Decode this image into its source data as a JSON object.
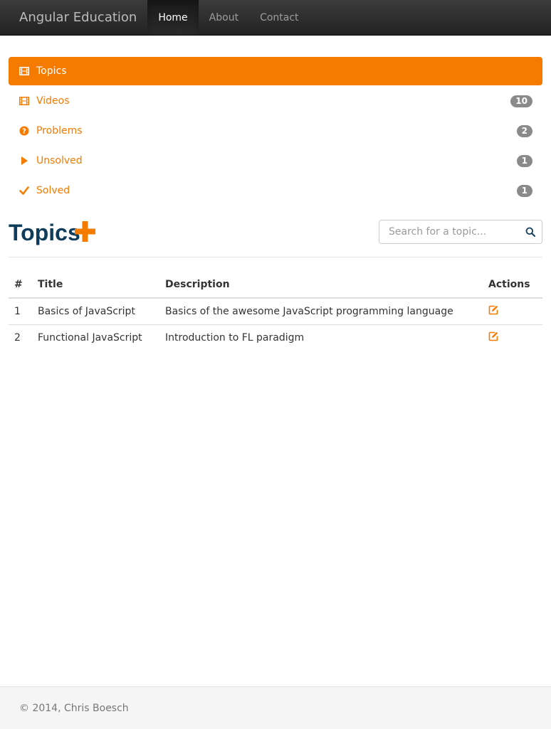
{
  "navbar": {
    "brand": "Angular Education",
    "links": [
      {
        "label": "Home",
        "active": true
      },
      {
        "label": "About",
        "active": false
      },
      {
        "label": "Contact",
        "active": false
      }
    ]
  },
  "menu": [
    {
      "label": "Topics",
      "icon": "film-icon",
      "badge": null,
      "active": true
    },
    {
      "label": "Videos",
      "icon": "film-icon",
      "badge": "10",
      "active": false
    },
    {
      "label": "Problems",
      "icon": "question-circle-icon",
      "badge": "2",
      "active": false
    },
    {
      "label": "Unsolved",
      "icon": "play-icon",
      "badge": "1",
      "active": false
    },
    {
      "label": "Solved",
      "icon": "check-icon",
      "badge": "1",
      "active": false
    }
  ],
  "topics": {
    "title": "Topics",
    "search_placeholder": "Search for a topic...",
    "columns": [
      "#",
      "Title",
      "Description",
      "Actions"
    ],
    "rows": [
      {
        "num": "1",
        "title": "Basics of JavaScript",
        "description": "Basics of the awesome JavaScript programming language"
      },
      {
        "num": "2",
        "title": "Functional JavaScript",
        "description": "Introduction to FL paradigm"
      }
    ]
  },
  "footer": {
    "text": "© 2014, Chris Boesch"
  },
  "colors": {
    "accent": "#f57a00",
    "title": "#0e3c5a",
    "badge": "#8a8a8a"
  }
}
